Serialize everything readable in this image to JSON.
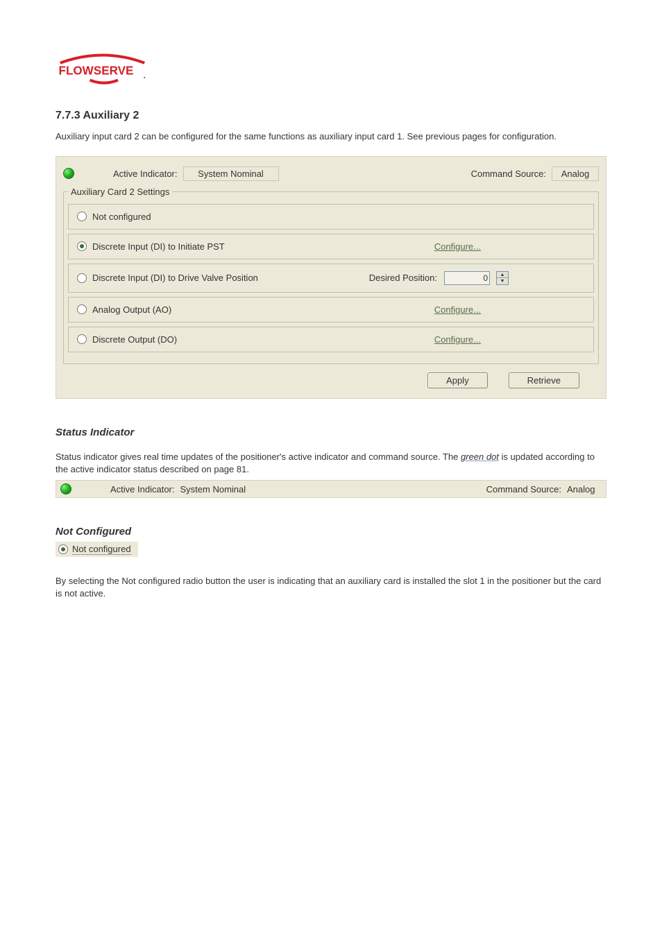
{
  "brand_name": "FLOWSERVE",
  "section_number_title": "7.7.3 Auxiliary 2",
  "intro_text": "Auxiliary input card 2 can be configured for the same functions as auxiliary input card 1. See previous pages for configuration.",
  "panel": {
    "active_indicator_label": "Active Indicator:",
    "active_indicator_value": "System Nominal",
    "command_source_label": "Command Source:",
    "command_source_value": "Analog",
    "fieldset_legend": "Auxiliary Card 2 Settings",
    "options": [
      {
        "label": "Not configured",
        "selected": false,
        "configure": false,
        "has_position": false
      },
      {
        "label": "Discrete Input (DI) to Initiate PST",
        "selected": true,
        "configure": true,
        "has_position": false
      },
      {
        "label": "Discrete Input (DI) to Drive Valve Position",
        "selected": false,
        "configure": false,
        "has_position": true
      },
      {
        "label": "Analog Output (AO)",
        "selected": false,
        "configure": true,
        "has_position": false
      },
      {
        "label": "Discrete Output (DO)",
        "selected": false,
        "configure": true,
        "has_position": false
      }
    ],
    "configure_label": "Configure...",
    "desired_position_label": "Desired Position:",
    "desired_position_value": "0",
    "apply_label": "Apply",
    "retrieve_label": "Retrieve"
  },
  "status_indicator_title": "Status Indicator",
  "status_indicator_text_1": "Status indicator gives real time updates of the positioner's active indicator and command source. The",
  "status_indicator_text_2": "is updated according to the active indicator status described on page 81.",
  "status_dot_word": "green dot",
  "not_configured_title": "Not Configured",
  "not_configured_inline_label": "Not configured",
  "not_configured_body": "By selecting the Not configured radio button the user is indicating that an auxiliary card is installed the slot 1 in the positioner but the card is not active."
}
